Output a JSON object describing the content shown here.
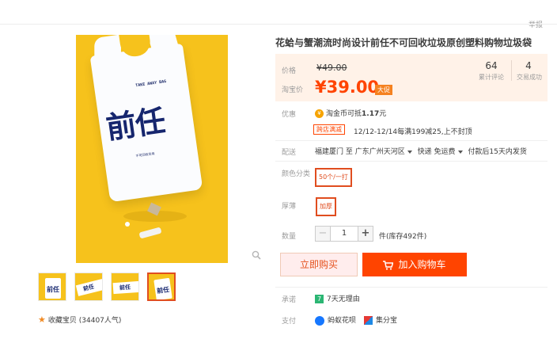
{
  "report_link": "举报",
  "product": {
    "title": "花蛤与蟹潮流时尚设计前任不可回收垃圾原创塑料购物垃圾袋",
    "image_text": {
      "small": "TAKE AWAY BAG",
      "big": "前任",
      "foot": "不可回收垃圾"
    }
  },
  "price": {
    "label": "价格",
    "original": "¥49.00",
    "taobao_label": "淘宝价",
    "current": "¥39.00",
    "tag": "大促"
  },
  "stats": {
    "reviews_num": "64",
    "reviews_label": "累计评论",
    "sales_num": "4",
    "sales_label": "交易成功"
  },
  "promo": {
    "label": "优惠",
    "coin_text": "淘金币可抵",
    "coin_amount": "1.17",
    "coin_unit": "元",
    "tag": "跨店满减",
    "detail": "12/12-12/14每满199减25,上不封顶"
  },
  "shipping": {
    "label": "配送",
    "from": "福建厦门 至",
    "to": "广东广州天河区",
    "express": "快递 免运费",
    "after_pay": "付款后15天内发货"
  },
  "color": {
    "label": "颜色分类",
    "option": "50个/一打"
  },
  "thickness": {
    "label": "厚薄",
    "option": "加厚"
  },
  "quantity": {
    "label": "数量",
    "minus": "−",
    "value": "1",
    "plus": "+",
    "stock": "件(库存492件)"
  },
  "buttons": {
    "buy_now": "立即购买",
    "add_cart": "加入购物车"
  },
  "promise": {
    "label": "承诺",
    "icon_text": "7",
    "text": "7天无理由"
  },
  "payment": {
    "label": "支付",
    "method1": "蚂蚁花呗",
    "method2": "集分宝"
  },
  "favorite": {
    "text": "收藏宝贝",
    "count": "(34407人气)"
  },
  "icons": {
    "star": "star-icon",
    "zoom": "magnifier-icon",
    "cart": "cart-icon",
    "coin": "coin-icon"
  },
  "colors": {
    "accent": "#ff4400",
    "price_bg": "#fff2e8",
    "image_bg": "#f6c21c",
    "bag_text": "#16266e"
  }
}
